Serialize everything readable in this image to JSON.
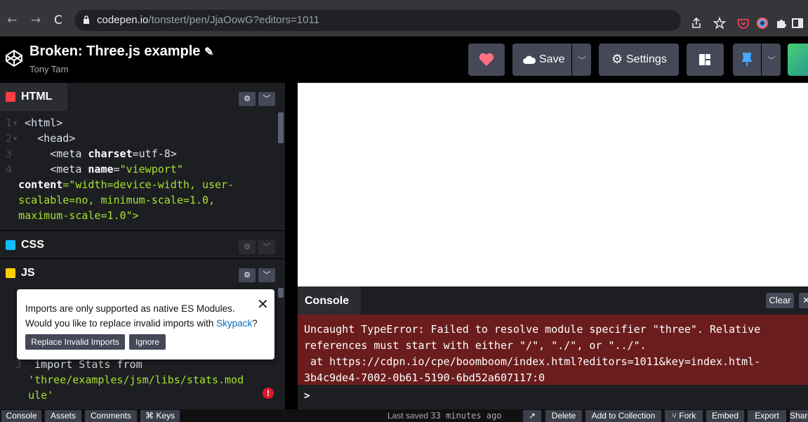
{
  "browser": {
    "url_domain": "codepen.io",
    "url_path": "/tonstert/pen/JjaOowG?editors=1011",
    "back_icon": "arrow-left-icon",
    "forward_icon": "arrow-right-icon",
    "reload_icon": "reload-icon"
  },
  "header": {
    "title": "Broken: Three.js example",
    "author": "Tony Tam",
    "save_label": "Save",
    "settings_label": "Settings"
  },
  "panes": {
    "html": {
      "label": "HTML"
    },
    "css": {
      "label": "CSS"
    },
    "js": {
      "label": "JS"
    }
  },
  "html_code": {
    "line1": "<html>",
    "line2": "<head>",
    "line3_tag": "<meta ",
    "line3_attr": "charset",
    "line3_rest": "=utf-8>",
    "line4_tag": "<meta ",
    "line4_attr": "name",
    "line4_str": "\"viewport\"",
    "wrap1_attr": "content",
    "wrap1_str": "=\"width=device-width, user-",
    "wrap2": "scalable=no, minimum-scale=1.0,",
    "wrap3": "maximum-scale=1.0\">"
  },
  "js_code": {
    "line3_kw": "import",
    "line3_id": " Stats ",
    "line3_kw2": "from",
    "wrap1": "'three/examples/jsm/libs/stats.mod",
    "wrap2": "ule'"
  },
  "popup": {
    "line1": "Imports are only supported as native ES Modules.",
    "line2": "Would you like to replace invalid imports with ",
    "link": "Skypack",
    "line2_end": "?",
    "replace_label": "Replace Invalid Imports",
    "ignore_label": "Ignore"
  },
  "console": {
    "label": "Console",
    "clear_label": "Clear",
    "error_line1": "Uncaught TypeError: Failed to resolve module specifier \"three\". Relative",
    "error_line2": "references must start with either \"/\", \"./\", or \"../\".",
    "error_line3": " at https://cdpn.io/cpe/boomboom/index.html?editors=1011&key=index.html-",
    "error_line4": "3b4c9de4-7002-0b61-5190-6bd52a607117:0",
    "prompt": ">"
  },
  "footer": {
    "console": "Console",
    "assets": "Assets",
    "comments": "Comments",
    "keys": "⌘ Keys",
    "last_saved_prefix": "Last saved ",
    "last_saved_time": "33 minutes ago",
    "delete": "Delete",
    "add_to_collection": "Add to Collection",
    "fork": "Fork",
    "embed": "Embed",
    "export": "Export",
    "share": "Share"
  },
  "colors": {
    "accent_pin": "#47cf73",
    "heart": "#ff7085",
    "html_icon": "#ff3c41",
    "css_icon": "#0ebeff",
    "js_icon": "#fcd000",
    "error_bg": "#6b1d1d"
  }
}
